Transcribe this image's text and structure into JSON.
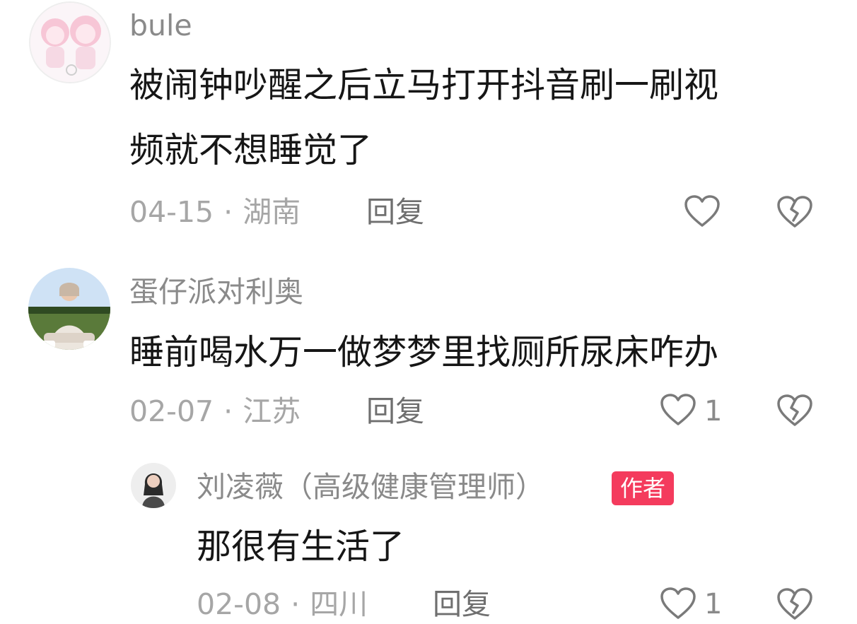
{
  "comments": [
    {
      "username": "bule",
      "text_lines": [
        "被闹钟吵醒之后立马打开抖音刷一刷视",
        "频就不想睡觉了"
      ],
      "date": "04-15",
      "location": "湖南",
      "reply_label": "回复",
      "like_count": ""
    },
    {
      "username": "蛋仔派对利奥",
      "text_lines": [
        "睡前喝水万一做梦梦里找厕所尿床咋办"
      ],
      "date": "02-07",
      "location": "江苏",
      "reply_label": "回复",
      "like_count": "1",
      "replies": [
        {
          "username": "刘凌薇（高级健康管理师）",
          "badge": "作者",
          "text_lines": [
            "那很有生活了"
          ],
          "date": "02-08",
          "location": "四川",
          "reply_label": "回复",
          "like_count": "1"
        }
      ]
    }
  ],
  "meta_separator": "·",
  "icons": {
    "like": "heart-outline-icon",
    "dislike": "broken-heart-icon"
  },
  "colors": {
    "author_badge": "#f43b5d",
    "username": "#8a8a8a",
    "meta": "#a6a6a6"
  }
}
